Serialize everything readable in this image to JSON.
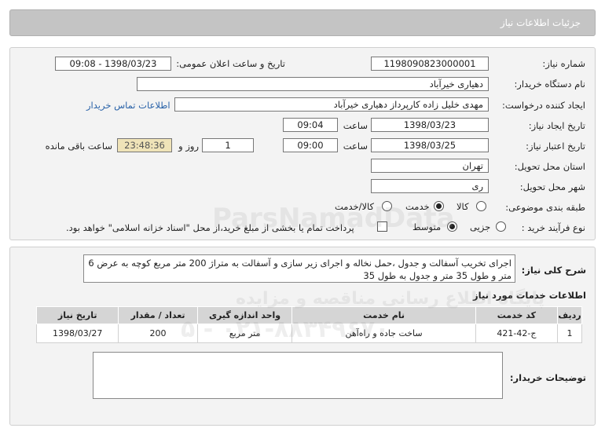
{
  "header": {
    "title": "جزئیات اطلاعات نیاز"
  },
  "labels": {
    "need_number": "شماره نیاز:",
    "public_announce": "تاریخ و ساعت اعلان عمومی:",
    "buyer_org": "نام دستگاه خریدار:",
    "requester": "ایجاد کننده درخواست:",
    "contact_link": "اطلاعات تماس خریدار",
    "create_date": "تاریخ ایجاد نیاز:",
    "time": "ساعت",
    "valid_date": "تاریخ اعتبار نیاز:",
    "day_and": "روز و",
    "remaining": "ساعت باقی مانده",
    "province": "استان محل تحویل:",
    "city": "شهر محل تحویل:",
    "category": "طبقه بندی موضوعی:",
    "purchase_type": "نوع فرآیند خرید :",
    "general_desc": "شرح کلی نیاز:",
    "services_info": "اطلاعات خدمات مورد نیاز",
    "buyer_notes": "توضیحات خریدار:"
  },
  "values": {
    "need_number": "1198090823000001",
    "public_announce": "1398/03/23 - 09:08",
    "buyer_org": "دهیاری خیرآباد",
    "requester": "مهدی خلیل زاده کارپرداز دهیاری خیرآباد",
    "create_date": "1398/03/23",
    "create_time": "09:04",
    "valid_date": "1398/03/25",
    "valid_time": "09:00",
    "days": "1",
    "remaining_time": "23:48:36",
    "province": "تهران",
    "city": "ری",
    "general_desc": "اجرای تخریب آسفالت و جدول ،حمل نخاله و اجرای  زیر سازی و آسفالت به متراژ 200 متر مربع  کوچه به عرض 6 متر و طول 35 متر و جدول  به طول 35"
  },
  "category_options": [
    {
      "label": "کالا",
      "selected": false
    },
    {
      "label": "خدمت",
      "selected": true
    },
    {
      "label": "کالا/خدمت",
      "selected": false
    }
  ],
  "purchase_options": [
    {
      "label": "جزیی",
      "selected": false
    },
    {
      "label": "متوسط",
      "selected": true
    }
  ],
  "payment_note": "پرداخت تمام یا بخشی از مبلغ خرید،از محل \"اسناد خزانه اسلامی\" خواهد بود.",
  "table": {
    "headers": [
      "ردیف",
      "کد خدمت",
      "نام خدمت",
      "واحد اندازه گیری",
      "تعداد / مقدار",
      "تاریخ نیاز"
    ],
    "rows": [
      [
        "1",
        "ج-42-421",
        "ساخت جاده و راه‌آهن",
        "متر مربع",
        "200",
        "1398/03/27"
      ]
    ]
  },
  "watermark": {
    "line1": "ParsNamadData",
    "line2": "پایگاه اطلاع رسانی مناقصه و مزایده",
    "line3": "۰۲۱-۸۸۳۴۹۶۷۰ - ۵"
  }
}
